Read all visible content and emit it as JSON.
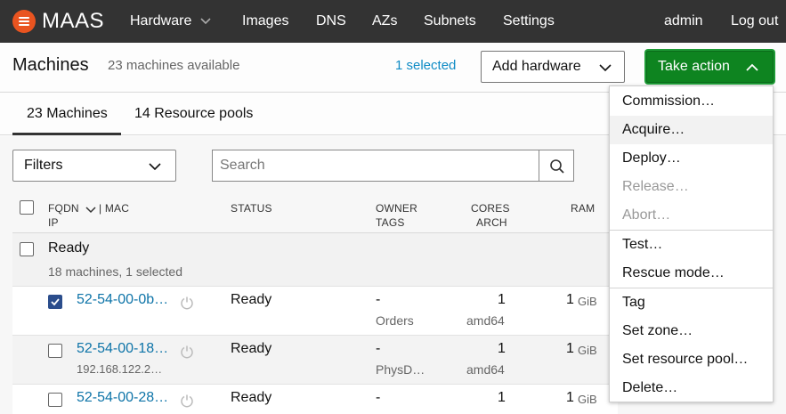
{
  "nav": {
    "logo_text": "MAAS",
    "items": [
      "Hardware",
      "Images",
      "DNS",
      "AZs",
      "Subnets",
      "Settings"
    ],
    "user": "admin",
    "logout": "Log out"
  },
  "header": {
    "title": "Machines",
    "subtitle": "23 machines available",
    "selected": "1 selected",
    "add_hardware": "Add hardware",
    "take_action": "Take action"
  },
  "tabs": [
    "23 Machines",
    "14 Resource pools"
  ],
  "toolbar": {
    "filters": "Filters",
    "search_placeholder": "Search"
  },
  "columns": {
    "fqdn": "FQDN",
    "mac": "| MAC",
    "ip": "IP",
    "status": "STATUS",
    "owner": "OWNER",
    "tags": "TAGS",
    "cores": "CORES",
    "arch": "ARCH",
    "ram": "RAM"
  },
  "group": {
    "title": "Ready",
    "meta": "18 machines, 1 selected"
  },
  "rows": [
    {
      "fqdn": "52-54-00-0b…",
      "ip": "",
      "status": "Ready",
      "owner": "-",
      "tags": "Orders",
      "cores": "1",
      "arch": "amd64",
      "ram": "1",
      "ram_unit": "GiB",
      "checked": true
    },
    {
      "fqdn": "52-54-00-18…",
      "ip": "192.168.122.2…",
      "status": "Ready",
      "owner": "-",
      "tags": "PhysD…",
      "cores": "1",
      "arch": "amd64",
      "ram": "1",
      "ram_unit": "GiB",
      "checked": false
    },
    {
      "fqdn": "52-54-00-28…",
      "ip": "",
      "status": "Ready",
      "owner": "-",
      "tags": "",
      "cores": "1",
      "arch": "",
      "ram": "1",
      "ram_unit": "GiB",
      "checked": false
    }
  ],
  "menu": {
    "items": [
      {
        "label": "Commission…"
      },
      {
        "label": "Acquire…"
      },
      {
        "label": "Deploy…"
      },
      {
        "label": "Release…"
      },
      {
        "label": "Abort…"
      },
      {
        "label": "Test…"
      },
      {
        "label": "Rescue mode…"
      },
      {
        "label": "Tag"
      },
      {
        "label": "Set zone…"
      },
      {
        "label": "Set resource pool…"
      },
      {
        "label": "Delete…"
      }
    ]
  },
  "colors": {
    "topbar": "#333333",
    "logo": "#e95420",
    "link": "#0e74a8",
    "action_green": "#0e8420",
    "checkbox_checked": "#2b4d8c"
  }
}
